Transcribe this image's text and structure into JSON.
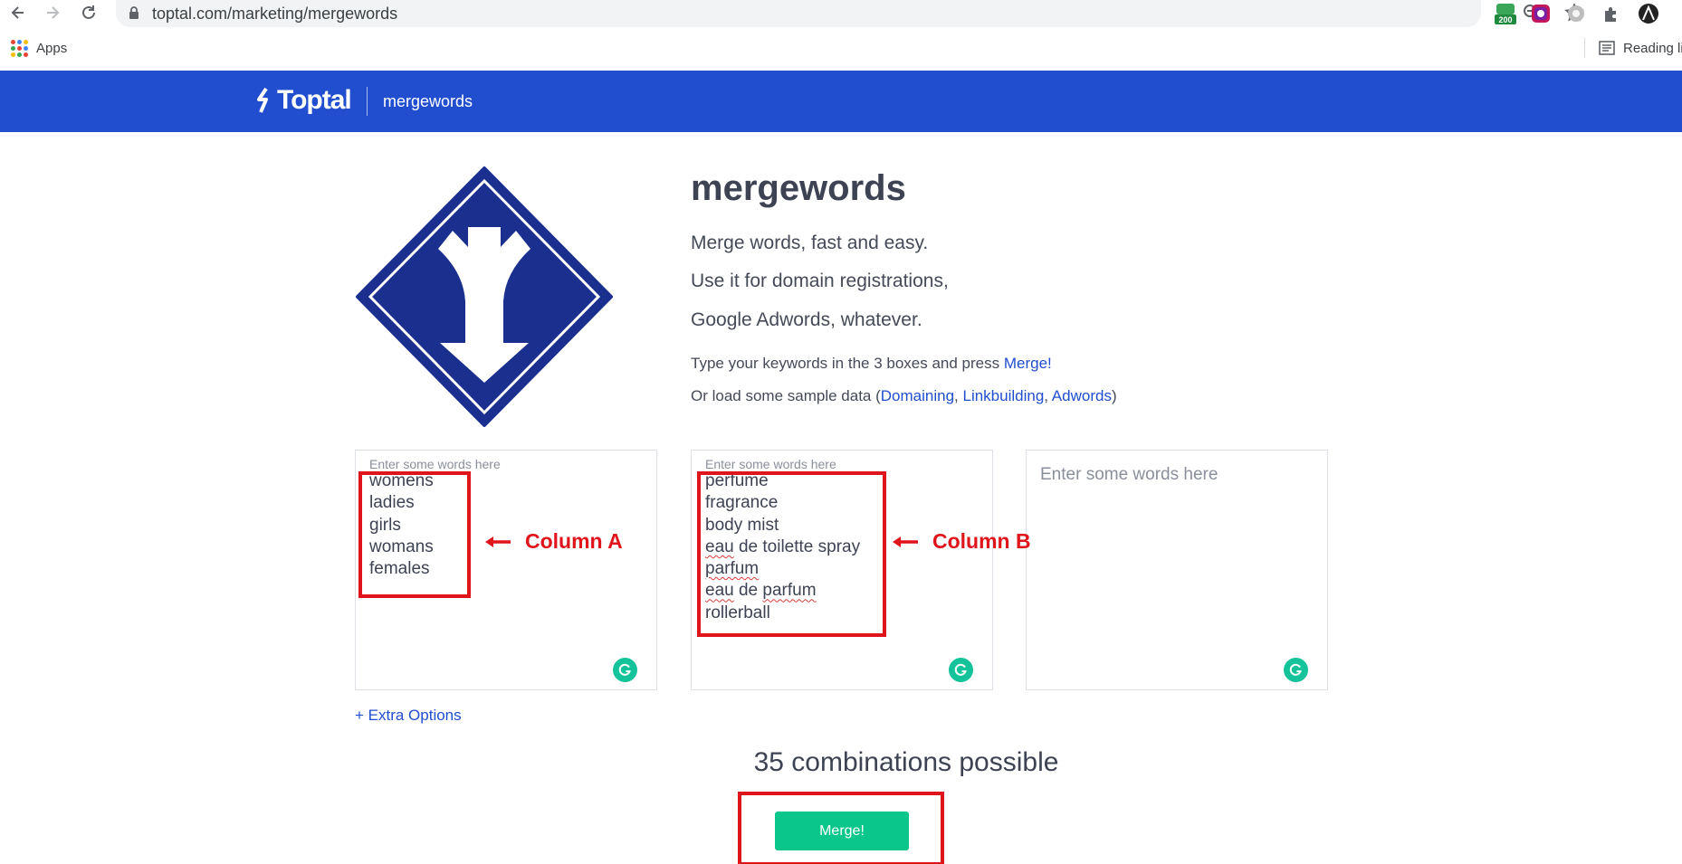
{
  "browser": {
    "url": "toptal.com/marketing/mergewords",
    "bookmarks_apps_label": "Apps",
    "reading_list_label": "Reading li",
    "extension_badge": "200"
  },
  "header": {
    "logo_text": "Toptal",
    "app_name": "mergewords"
  },
  "hero": {
    "title": "mergewords",
    "taglines": [
      "Merge words, fast and easy.",
      "Use it for domain registrations,",
      "Google Adwords, whatever."
    ],
    "instruction_prefix": "Type your keywords in the 3 boxes and press ",
    "instruction_link": "Merge!",
    "sample_prefix": "Or load some sample data (",
    "sample_links": [
      "Domaining",
      "Linkbuilding",
      "Adwords"
    ],
    "sample_sep": ", ",
    "sample_suffix": ")"
  },
  "columns": [
    {
      "placeholder": "Enter some words here",
      "words": [
        "womens",
        "ladies",
        "girls",
        "womans",
        "females"
      ],
      "annotation": "Column A"
    },
    {
      "placeholder": "Enter some words here",
      "words": [
        "perfume",
        "fragrance",
        "body mist",
        "eau de toilette spray",
        "parfum",
        "eau de parfum",
        "rollerball"
      ],
      "annotation": "Column B"
    },
    {
      "placeholder": "Enter some words here",
      "words": []
    }
  ],
  "extra_options_label": "+ Extra Options",
  "combinations_text": "35 combinations possible",
  "merge_button_label": "Merge!",
  "colors": {
    "brand_blue": "#204ecf",
    "merge_green": "#0bc68a",
    "annotation_red": "#e0141b",
    "grammarly_green": "#15c39a"
  }
}
